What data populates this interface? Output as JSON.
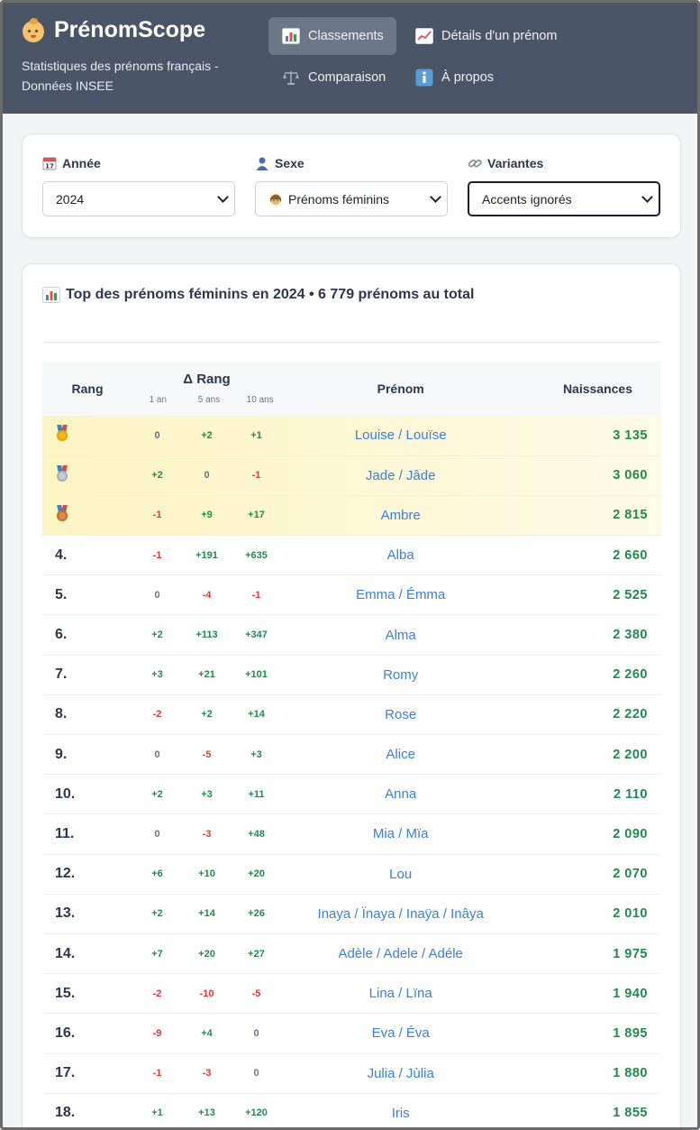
{
  "brand": {
    "title": "PrénomScope",
    "subtitle": "Statistiques des prénoms français - Données INSEE",
    "icon": "baby-icon"
  },
  "nav": [
    {
      "label": "Classements",
      "icon": "bar-chart-icon",
      "active": true
    },
    {
      "label": "Détails d'un prénom",
      "icon": "trend-chart-icon",
      "active": false
    },
    {
      "label": "Comparaison",
      "icon": "scales-icon",
      "active": false
    },
    {
      "label": "À propos",
      "icon": "info-icon",
      "active": false
    }
  ],
  "filters": {
    "year": {
      "label": "Année",
      "icon": "calendar-icon",
      "value": "2024"
    },
    "sex": {
      "label": "Sexe",
      "icon": "person-icon",
      "value": "Prénoms féminins",
      "value_icon": "girl-icon"
    },
    "variants": {
      "label": "Variantes",
      "icon": "link-icon",
      "value": "Accents ignorés"
    }
  },
  "results": {
    "title": "Top des prénoms féminins en 2024 • 6 779 prénoms au total",
    "icon": "bar-chart-icon",
    "columns": {
      "rank": "Rang",
      "delta": "Δ Rang",
      "delta_1": "1 an",
      "delta_5": "5 ans",
      "delta_10": "10 ans",
      "name": "Prénom",
      "births": "Naissances"
    },
    "rows": [
      {
        "rank": "",
        "medal": "gold",
        "d1": "0",
        "d5": "+2",
        "d10": "+1",
        "name": "Louise / Louïse",
        "births": "3 135"
      },
      {
        "rank": "",
        "medal": "silver",
        "d1": "+2",
        "d5": "0",
        "d10": "-1",
        "name": "Jade / Jâde",
        "births": "3 060"
      },
      {
        "rank": "",
        "medal": "bronze",
        "d1": "-1",
        "d5": "+9",
        "d10": "+17",
        "name": "Ambre",
        "births": "2 815"
      },
      {
        "rank": "4.",
        "d1": "-1",
        "d5": "+191",
        "d10": "+635",
        "name": "Alba",
        "births": "2 660"
      },
      {
        "rank": "5.",
        "d1": "0",
        "d5": "-4",
        "d10": "-1",
        "name": "Emma / Émma",
        "births": "2 525"
      },
      {
        "rank": "6.",
        "d1": "+2",
        "d5": "+113",
        "d10": "+347",
        "name": "Alma",
        "births": "2 380"
      },
      {
        "rank": "7.",
        "d1": "+3",
        "d5": "+21",
        "d10": "+101",
        "name": "Romy",
        "births": "2 260"
      },
      {
        "rank": "8.",
        "d1": "-2",
        "d5": "+2",
        "d10": "+14",
        "name": "Rose",
        "births": "2 220"
      },
      {
        "rank": "9.",
        "d1": "0",
        "d5": "-5",
        "d10": "+3",
        "name": "Alice",
        "births": "2 200"
      },
      {
        "rank": "10.",
        "d1": "+2",
        "d5": "+3",
        "d10": "+11",
        "name": "Anna",
        "births": "2 110"
      },
      {
        "rank": "11.",
        "d1": "0",
        "d5": "-3",
        "d10": "+48",
        "name": "Mia / Mïa",
        "births": "2 090"
      },
      {
        "rank": "12.",
        "d1": "+6",
        "d5": "+10",
        "d10": "+20",
        "name": "Lou",
        "births": "2 070"
      },
      {
        "rank": "13.",
        "d1": "+2",
        "d5": "+14",
        "d10": "+26",
        "name": "Inaya / Ïnaya / Inaÿa / Inâya",
        "births": "2 010"
      },
      {
        "rank": "14.",
        "d1": "+7",
        "d5": "+20",
        "d10": "+27",
        "name": "Adèle / Adele / Adéle",
        "births": "1 975"
      },
      {
        "rank": "15.",
        "d1": "-2",
        "d5": "-10",
        "d10": "-5",
        "name": "Lina / Lïna",
        "births": "1 940"
      },
      {
        "rank": "16.",
        "d1": "-9",
        "d5": "+4",
        "d10": "0",
        "name": "Eva / Éva",
        "births": "1 895"
      },
      {
        "rank": "17.",
        "d1": "-1",
        "d5": "-3",
        "d10": "0",
        "name": "Julia / Jùlia",
        "births": "1 880"
      },
      {
        "rank": "18.",
        "d1": "+1",
        "d5": "+13",
        "d10": "+120",
        "name": "Iris",
        "births": "1 855"
      }
    ]
  }
}
